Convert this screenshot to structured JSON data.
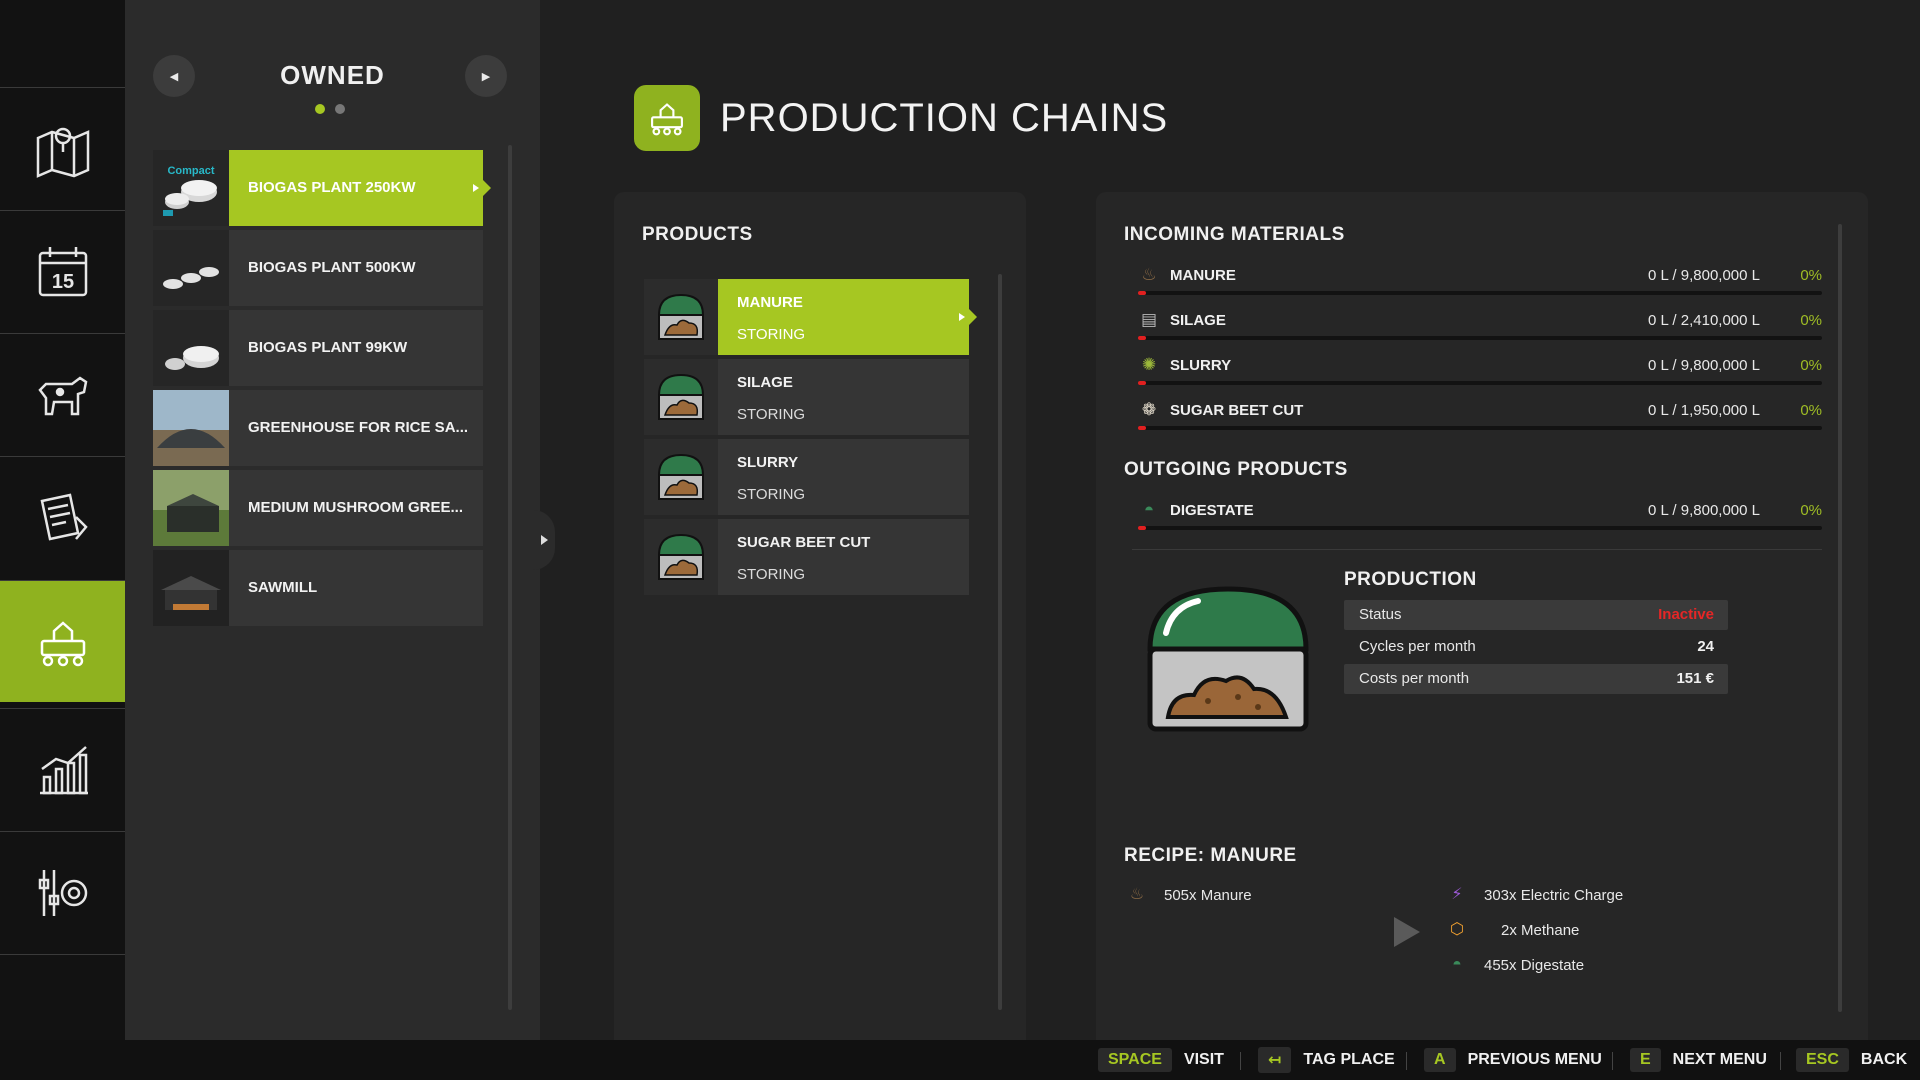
{
  "sidebar": {
    "items": [
      {
        "icon": "map-icon"
      },
      {
        "icon": "calendar-icon",
        "day": "15"
      },
      {
        "icon": "animals-icon"
      },
      {
        "icon": "contracts-icon"
      },
      {
        "icon": "production-icon",
        "active": true
      },
      {
        "icon": "statistics-icon"
      },
      {
        "icon": "settings-icon"
      }
    ]
  },
  "owned": {
    "title": "OWNED",
    "prev": "◀",
    "next": "▶",
    "items": [
      {
        "label": "BIOGAS PLANT 250KW",
        "thumb_text": "Compact",
        "active": true
      },
      {
        "label": "BIOGAS PLANT 500KW"
      },
      {
        "label": "BIOGAS PLANT 99KW"
      },
      {
        "label": "GREENHOUSE FOR RICE SA..."
      },
      {
        "label": "MEDIUM MUSHROOM GREE..."
      },
      {
        "label": "SAWMILL"
      }
    ]
  },
  "header": {
    "title": "PRODUCTION CHAINS"
  },
  "products": {
    "title": "PRODUCTS",
    "items": [
      {
        "name": "MANURE",
        "status": "STORING",
        "active": true
      },
      {
        "name": "SILAGE",
        "status": "STORING"
      },
      {
        "name": "SLURRY",
        "status": "STORING"
      },
      {
        "name": "SUGAR BEET CUT",
        "status": "STORING"
      }
    ]
  },
  "incoming": {
    "title": "INCOMING MATERIALS",
    "items": [
      {
        "name": "MANURE",
        "amount": "0 L / 9,800,000 L",
        "pct": "0%"
      },
      {
        "name": "SILAGE",
        "amount": "0 L / 2,410,000 L",
        "pct": "0%"
      },
      {
        "name": "SLURRY",
        "amount": "0 L / 9,800,000 L",
        "pct": "0%"
      },
      {
        "name": "SUGAR BEET CUT",
        "amount": "0 L / 1,950,000 L",
        "pct": "0%"
      }
    ]
  },
  "outgoing": {
    "title": "OUTGOING PRODUCTS",
    "items": [
      {
        "name": "DIGESTATE",
        "amount": "0 L / 9,800,000 L",
        "pct": "0%"
      }
    ]
  },
  "production": {
    "title": "PRODUCTION",
    "rows": [
      {
        "key": "Status",
        "value": "Inactive"
      },
      {
        "key": "Cycles per month",
        "value": "24"
      },
      {
        "key": "Costs per month",
        "value": "151 €"
      }
    ]
  },
  "recipe": {
    "title": "RECIPE: MANURE",
    "inputs": [
      {
        "label": "505x Manure"
      }
    ],
    "outputs": [
      {
        "label": "303x Electric Charge"
      },
      {
        "label": "2x Methane"
      },
      {
        "label": "455x Digestate"
      }
    ]
  },
  "hints": [
    {
      "key": "SPACE",
      "label": "VISIT"
    },
    {
      "key": "↤",
      "label": "TAG PLACE"
    },
    {
      "key": "A",
      "label": "PREVIOUS MENU"
    },
    {
      "key": "E",
      "label": "NEXT MENU"
    },
    {
      "key": "ESC",
      "label": "BACK"
    }
  ],
  "colors": {
    "accent": "#a6c722",
    "inactive": "#e52626",
    "bar_fill": "#e02020"
  }
}
